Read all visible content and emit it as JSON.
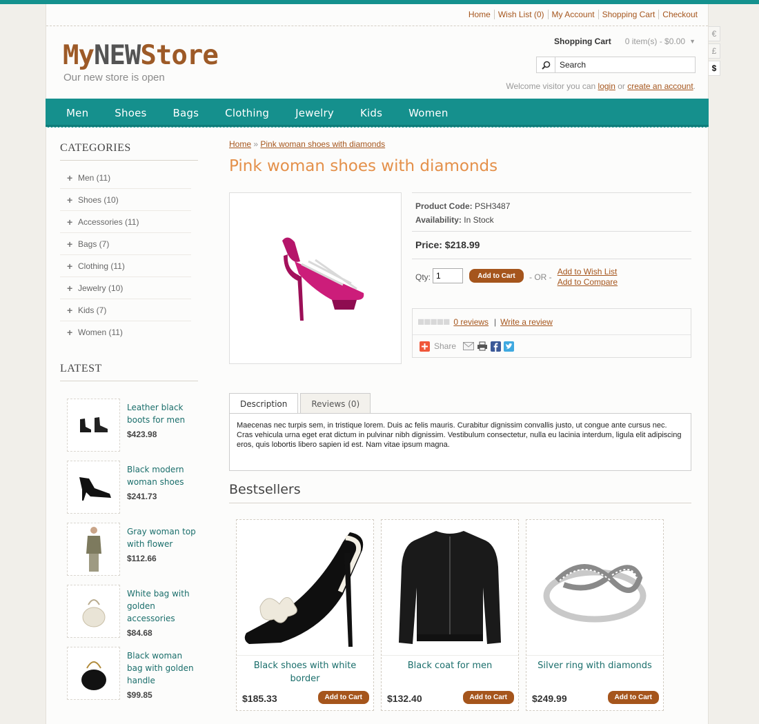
{
  "toplinks": [
    "Home",
    "Wish List (0)",
    "My Account",
    "Shopping Cart",
    "Checkout"
  ],
  "logo": {
    "part1": "My",
    "part2": "NEW",
    "part3": "Store",
    "tagline": "Our new store is open"
  },
  "cart": {
    "label": "Shopping Cart",
    "value": "0 item(s) - $0.00"
  },
  "search": {
    "value": "Search"
  },
  "welcome": {
    "prefix": "Welcome visitor you can",
    "login": "login",
    "or": "or",
    "create": "create an account",
    "suffix": "."
  },
  "currencies": [
    "€",
    "£",
    "$"
  ],
  "nav": [
    "Men",
    "Shoes",
    "Bags",
    "Clothing",
    "Jewelry",
    "Kids",
    "Women"
  ],
  "sidebar": {
    "categories_title": "CATEGORIES",
    "categories": [
      "Men (11)",
      "Shoes (10)",
      "Accessories (11)",
      "Bags (7)",
      "Clothing (11)",
      "Jewelry (10)",
      "Kids (7)",
      "Women (11)"
    ],
    "latest_title": "LATEST",
    "latest": [
      {
        "name": "Leather black boots for men",
        "price": "$423.98"
      },
      {
        "name": "Black modern woman shoes",
        "price": "$241.73"
      },
      {
        "name": "Gray woman top with flower",
        "price": "$112.66"
      },
      {
        "name": "White bag with golden accessories",
        "price": "$84.68"
      },
      {
        "name": "Black woman bag with golden handle",
        "price": "$99.85"
      }
    ]
  },
  "breadcrumb": {
    "home": "Home",
    "sep": "»",
    "current": "Pink woman shoes with diamonds"
  },
  "product": {
    "title": "Pink woman shoes with diamonds",
    "code_label": "Product Code:",
    "code": "PSH3487",
    "avail_label": "Availability:",
    "avail": "In Stock",
    "price": "Price: $218.99",
    "qty_label": "Qty:",
    "qty": "1",
    "add_to_cart": "Add to Cart",
    "or": "- OR -",
    "wishlist": "Add to Wish List",
    "compare": "Add to Compare",
    "reviews": "0 reviews",
    "review_sep": "|",
    "write_review": "Write a review",
    "share": "Share"
  },
  "tabs": {
    "description": "Description",
    "reviews": "Reviews (0)",
    "body": "Maecenas nec turpis sem, in tristique lorem. Duis ac felis mauris. Curabitur dignissim convallis justo, ut congue ante cursus nec. Cras vehicula urna eget erat dictum in pulvinar nibh dignissim. Vestibulum consectetur, nulla eu lacinia interdum, ligula elit adipiscing eros, quis lobortis libero sapien id est. Nam vitae ipsum magna."
  },
  "bestsellers": {
    "title": "Bestsellers",
    "items": [
      {
        "name": "Black shoes with white border",
        "price": "$185.33",
        "button": "Add to Cart"
      },
      {
        "name": "Black coat for men",
        "price": "$132.40",
        "button": "Add to Cart"
      },
      {
        "name": "Silver ring with diamonds",
        "price": "$249.99",
        "button": "Add to Cart"
      }
    ]
  }
}
